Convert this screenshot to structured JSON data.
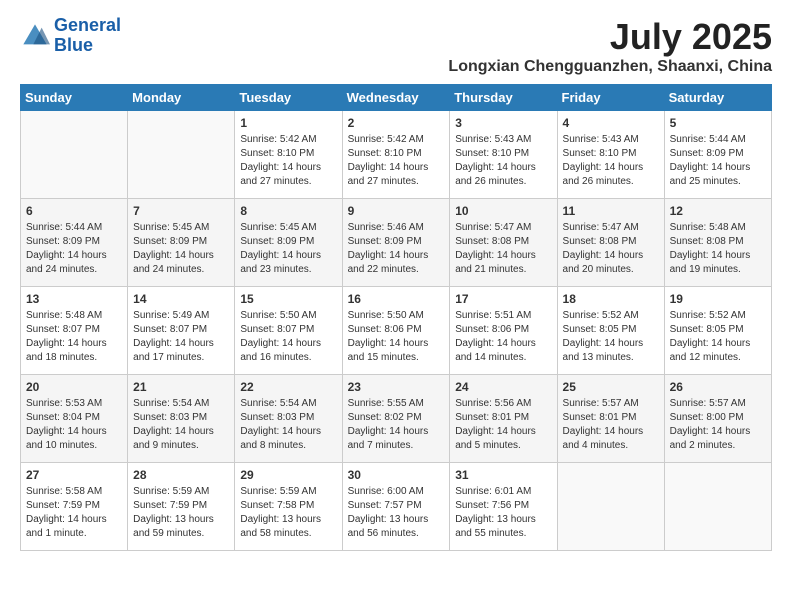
{
  "logo": {
    "line1": "General",
    "line2": "Blue"
  },
  "title": "July 2025",
  "location": "Longxian Chengguanzhen, Shaanxi, China",
  "days_of_week": [
    "Sunday",
    "Monday",
    "Tuesday",
    "Wednesday",
    "Thursday",
    "Friday",
    "Saturday"
  ],
  "weeks": [
    [
      {
        "day": "",
        "content": ""
      },
      {
        "day": "",
        "content": ""
      },
      {
        "day": "1",
        "content": "Sunrise: 5:42 AM\nSunset: 8:10 PM\nDaylight: 14 hours and 27 minutes."
      },
      {
        "day": "2",
        "content": "Sunrise: 5:42 AM\nSunset: 8:10 PM\nDaylight: 14 hours and 27 minutes."
      },
      {
        "day": "3",
        "content": "Sunrise: 5:43 AM\nSunset: 8:10 PM\nDaylight: 14 hours and 26 minutes."
      },
      {
        "day": "4",
        "content": "Sunrise: 5:43 AM\nSunset: 8:10 PM\nDaylight: 14 hours and 26 minutes."
      },
      {
        "day": "5",
        "content": "Sunrise: 5:44 AM\nSunset: 8:09 PM\nDaylight: 14 hours and 25 minutes."
      }
    ],
    [
      {
        "day": "6",
        "content": "Sunrise: 5:44 AM\nSunset: 8:09 PM\nDaylight: 14 hours and 24 minutes."
      },
      {
        "day": "7",
        "content": "Sunrise: 5:45 AM\nSunset: 8:09 PM\nDaylight: 14 hours and 24 minutes."
      },
      {
        "day": "8",
        "content": "Sunrise: 5:45 AM\nSunset: 8:09 PM\nDaylight: 14 hours and 23 minutes."
      },
      {
        "day": "9",
        "content": "Sunrise: 5:46 AM\nSunset: 8:09 PM\nDaylight: 14 hours and 22 minutes."
      },
      {
        "day": "10",
        "content": "Sunrise: 5:47 AM\nSunset: 8:08 PM\nDaylight: 14 hours and 21 minutes."
      },
      {
        "day": "11",
        "content": "Sunrise: 5:47 AM\nSunset: 8:08 PM\nDaylight: 14 hours and 20 minutes."
      },
      {
        "day": "12",
        "content": "Sunrise: 5:48 AM\nSunset: 8:08 PM\nDaylight: 14 hours and 19 minutes."
      }
    ],
    [
      {
        "day": "13",
        "content": "Sunrise: 5:48 AM\nSunset: 8:07 PM\nDaylight: 14 hours and 18 minutes."
      },
      {
        "day": "14",
        "content": "Sunrise: 5:49 AM\nSunset: 8:07 PM\nDaylight: 14 hours and 17 minutes."
      },
      {
        "day": "15",
        "content": "Sunrise: 5:50 AM\nSunset: 8:07 PM\nDaylight: 14 hours and 16 minutes."
      },
      {
        "day": "16",
        "content": "Sunrise: 5:50 AM\nSunset: 8:06 PM\nDaylight: 14 hours and 15 minutes."
      },
      {
        "day": "17",
        "content": "Sunrise: 5:51 AM\nSunset: 8:06 PM\nDaylight: 14 hours and 14 minutes."
      },
      {
        "day": "18",
        "content": "Sunrise: 5:52 AM\nSunset: 8:05 PM\nDaylight: 14 hours and 13 minutes."
      },
      {
        "day": "19",
        "content": "Sunrise: 5:52 AM\nSunset: 8:05 PM\nDaylight: 14 hours and 12 minutes."
      }
    ],
    [
      {
        "day": "20",
        "content": "Sunrise: 5:53 AM\nSunset: 8:04 PM\nDaylight: 14 hours and 10 minutes."
      },
      {
        "day": "21",
        "content": "Sunrise: 5:54 AM\nSunset: 8:03 PM\nDaylight: 14 hours and 9 minutes."
      },
      {
        "day": "22",
        "content": "Sunrise: 5:54 AM\nSunset: 8:03 PM\nDaylight: 14 hours and 8 minutes."
      },
      {
        "day": "23",
        "content": "Sunrise: 5:55 AM\nSunset: 8:02 PM\nDaylight: 14 hours and 7 minutes."
      },
      {
        "day": "24",
        "content": "Sunrise: 5:56 AM\nSunset: 8:01 PM\nDaylight: 14 hours and 5 minutes."
      },
      {
        "day": "25",
        "content": "Sunrise: 5:57 AM\nSunset: 8:01 PM\nDaylight: 14 hours and 4 minutes."
      },
      {
        "day": "26",
        "content": "Sunrise: 5:57 AM\nSunset: 8:00 PM\nDaylight: 14 hours and 2 minutes."
      }
    ],
    [
      {
        "day": "27",
        "content": "Sunrise: 5:58 AM\nSunset: 7:59 PM\nDaylight: 14 hours and 1 minute."
      },
      {
        "day": "28",
        "content": "Sunrise: 5:59 AM\nSunset: 7:59 PM\nDaylight: 13 hours and 59 minutes."
      },
      {
        "day": "29",
        "content": "Sunrise: 5:59 AM\nSunset: 7:58 PM\nDaylight: 13 hours and 58 minutes."
      },
      {
        "day": "30",
        "content": "Sunrise: 6:00 AM\nSunset: 7:57 PM\nDaylight: 13 hours and 56 minutes."
      },
      {
        "day": "31",
        "content": "Sunrise: 6:01 AM\nSunset: 7:56 PM\nDaylight: 13 hours and 55 minutes."
      },
      {
        "day": "",
        "content": ""
      },
      {
        "day": "",
        "content": ""
      }
    ]
  ]
}
